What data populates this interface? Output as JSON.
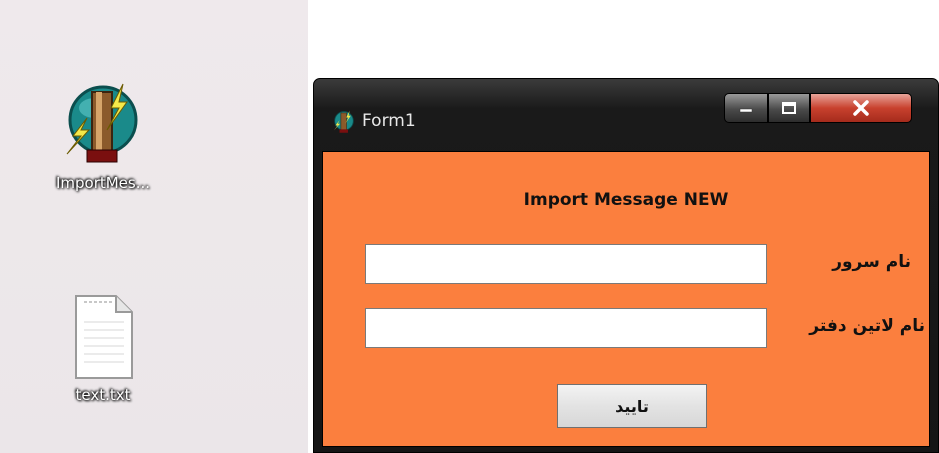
{
  "desktop": {
    "icons": [
      {
        "label": "ImportMes...",
        "icon": "app-lightning-icon"
      },
      {
        "label": "text.txt",
        "icon": "text-file-icon"
      }
    ]
  },
  "window": {
    "title": "Form1",
    "icon": "app-lightning-icon",
    "controls": {
      "minimize": "minimize-icon",
      "maximize": "maximize-icon",
      "close": "close-icon"
    },
    "heading": "Import Message NEW",
    "fields": [
      {
        "label": "نام سرور",
        "value": ""
      },
      {
        "label": "نام لاتین دفتر",
        "value": ""
      }
    ],
    "ok_button": "تایید"
  },
  "colors": {
    "form_background": "#fb7f3e"
  }
}
